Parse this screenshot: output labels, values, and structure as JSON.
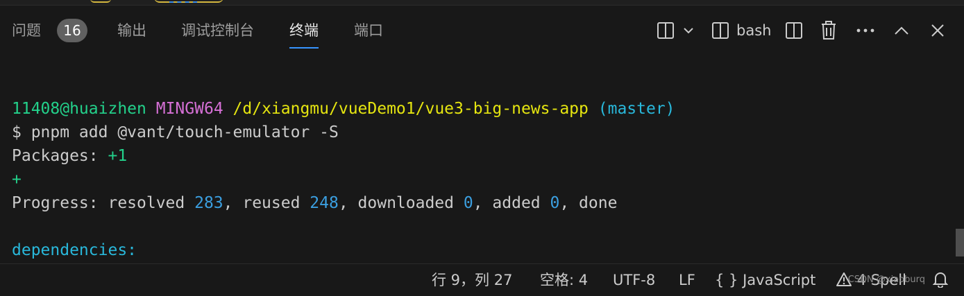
{
  "panel": {
    "tabs": [
      {
        "label": "问题",
        "badge": "16"
      },
      {
        "label": "输出"
      },
      {
        "label": "调试控制台"
      },
      {
        "label": "终端"
      },
      {
        "label": "端口"
      }
    ],
    "active_tab": "终端",
    "toolbar": {
      "terminal_name": "bash",
      "icons": [
        "split-terminal-icon",
        "chevron-down-icon",
        "terminal-instance-icon",
        "split-icon",
        "trash-icon",
        "more-icon",
        "maximize-chevron-up-icon",
        "close-icon"
      ]
    }
  },
  "terminal": {
    "prompt": {
      "user": "11408@huaizhen",
      "host": "MINGW64",
      "path": "/d/xiangmu/vueDemo1/vue3-big-news-app",
      "branch": "(master)"
    },
    "command": "$ pnpm add @vant/touch-emulator -S",
    "packages_label": "Packages: ",
    "packages_value": "+1",
    "plus_line": "+",
    "progress": {
      "prefix": "Progress: resolved ",
      "resolved": "283",
      "reused_label": ", reused ",
      "reused": "248",
      "downloaded_label": ", downloaded ",
      "downloaded": "0",
      "added_label": ", added ",
      "added": "0",
      "done_label": ", done"
    },
    "dependencies_label": "dependencies:"
  },
  "statusbar": {
    "position": "行 9，列 27",
    "spaces": "空格: 4",
    "encoding": "UTF-8",
    "eol": "LF",
    "language_icon": "{ }",
    "language": "JavaScript",
    "spell": "4 Spell",
    "watermark": "CSDN @xiaoburq"
  },
  "colors": {
    "background": "#181818",
    "accent": "#3794ff",
    "prompt_user": "#23d18b",
    "prompt_host": "#d670d6",
    "prompt_path": "#e5e510",
    "prompt_branch": "#29b8db"
  }
}
